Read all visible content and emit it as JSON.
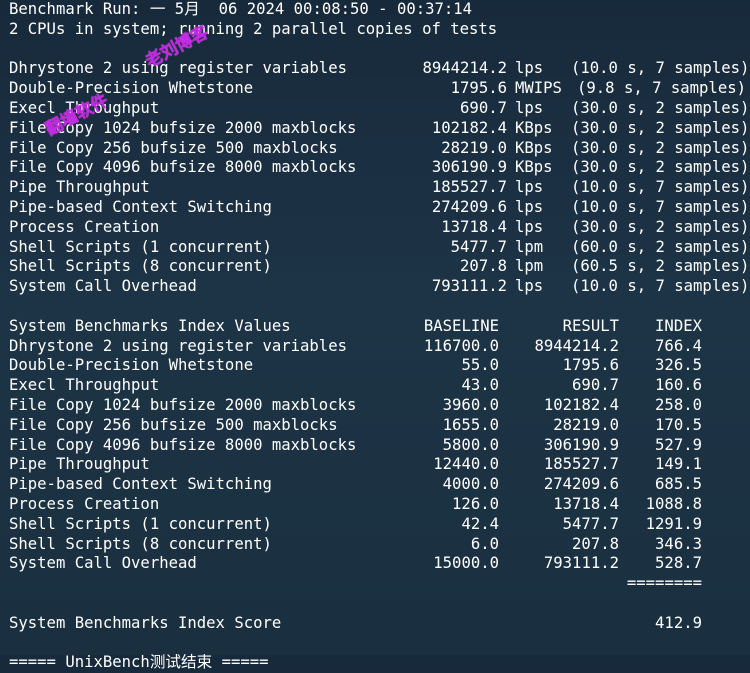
{
  "header": {
    "line1": "Benchmark Run: 一 5月  06 2024 00:08:50 - 00:37:14",
    "line2": "2 CPUs in system; running 2 parallel copies of tests"
  },
  "watermark": {
    "text1": "老刘博客",
    "text2": "翻墙软件"
  },
  "results": [
    {
      "name": "Dhrystone 2 using register variables",
      "value": "8944214.2",
      "unit": "lps",
      "info": "(10.0 s, 7 samples)"
    },
    {
      "name": "Double-Precision Whetstone",
      "value": "1795.6",
      "unit": "MWIPS",
      "info": "(9.8 s, 7 samples)"
    },
    {
      "name": "Execl Throughput",
      "value": "690.7",
      "unit": "lps",
      "info": "(30.0 s, 2 samples)"
    },
    {
      "name": "File Copy 1024 bufsize 2000 maxblocks",
      "value": "102182.4",
      "unit": "KBps",
      "info": "(30.0 s, 2 samples)"
    },
    {
      "name": "File Copy 256 bufsize 500 maxblocks",
      "value": "28219.0",
      "unit": "KBps",
      "info": "(30.0 s, 2 samples)"
    },
    {
      "name": "File Copy 4096 bufsize 8000 maxblocks",
      "value": "306190.9",
      "unit": "KBps",
      "info": "(30.0 s, 2 samples)"
    },
    {
      "name": "Pipe Throughput",
      "value": "185527.7",
      "unit": "lps",
      "info": "(10.0 s, 7 samples)"
    },
    {
      "name": "Pipe-based Context Switching",
      "value": "274209.6",
      "unit": "lps",
      "info": "(10.0 s, 7 samples)"
    },
    {
      "name": "Process Creation",
      "value": "13718.4",
      "unit": "lps",
      "info": "(30.0 s, 2 samples)"
    },
    {
      "name": "Shell Scripts (1 concurrent)",
      "value": "5477.7",
      "unit": "lpm",
      "info": "(60.0 s, 2 samples)"
    },
    {
      "name": "Shell Scripts (8 concurrent)",
      "value": "207.8",
      "unit": "lpm",
      "info": "(60.5 s, 2 samples)"
    },
    {
      "name": "System Call Overhead",
      "value": "793111.2",
      "unit": "lps",
      "info": "(10.0 s, 7 samples)"
    }
  ],
  "index_table": {
    "title": "System Benchmarks Index Values",
    "col_baseline": "BASELINE",
    "col_result": "RESULT",
    "col_index": "INDEX",
    "rows": [
      {
        "name": "Dhrystone 2 using register variables",
        "baseline": "116700.0",
        "result": "8944214.2",
        "index": "766.4"
      },
      {
        "name": "Double-Precision Whetstone",
        "baseline": "55.0",
        "result": "1795.6",
        "index": "326.5"
      },
      {
        "name": "Execl Throughput",
        "baseline": "43.0",
        "result": "690.7",
        "index": "160.6"
      },
      {
        "name": "File Copy 1024 bufsize 2000 maxblocks",
        "baseline": "3960.0",
        "result": "102182.4",
        "index": "258.0"
      },
      {
        "name": "File Copy 256 bufsize 500 maxblocks",
        "baseline": "1655.0",
        "result": "28219.0",
        "index": "170.5"
      },
      {
        "name": "File Copy 4096 bufsize 8000 maxblocks",
        "baseline": "5800.0",
        "result": "306190.9",
        "index": "527.9"
      },
      {
        "name": "Pipe Throughput",
        "baseline": "12440.0",
        "result": "185527.7",
        "index": "149.1"
      },
      {
        "name": "Pipe-based Context Switching",
        "baseline": "4000.0",
        "result": "274209.6",
        "index": "685.5"
      },
      {
        "name": "Process Creation",
        "baseline": "126.0",
        "result": "13718.4",
        "index": "1088.8"
      },
      {
        "name": "Shell Scripts (1 concurrent)",
        "baseline": "42.4",
        "result": "5477.7",
        "index": "1291.9"
      },
      {
        "name": "Shell Scripts (8 concurrent)",
        "baseline": "6.0",
        "result": "207.8",
        "index": "346.3"
      },
      {
        "name": "System Call Overhead",
        "baseline": "15000.0",
        "result": "793111.2",
        "index": "528.7"
      }
    ],
    "separator": "========",
    "score_label": "System Benchmarks Index Score",
    "score_value": "412.9"
  },
  "footer": "===== UnixBench测试结束 ====="
}
